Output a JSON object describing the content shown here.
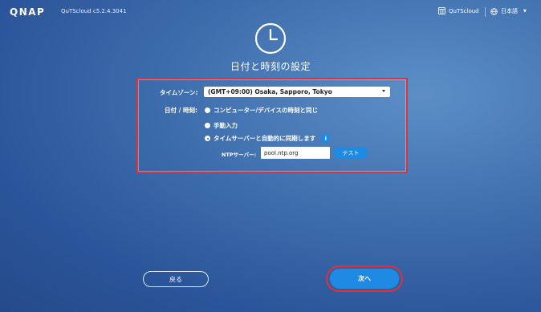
{
  "header": {
    "logo": "QNAP",
    "version": "QuTScloud c5.2.4.3041",
    "product_link": "QuTScloud",
    "language": "日本語"
  },
  "page": {
    "title": "日付と時刻の設定"
  },
  "form": {
    "timezone_label": "タイムゾーン:",
    "timezone_value": "(GMT+09:00) Osaka, Sapporo, Tokyo",
    "datetime_label": "日付 / 時刻:",
    "options": [
      {
        "label": "コンピューター/デバイスの時刻と同じ",
        "selected": false
      },
      {
        "label": "手動入力",
        "selected": false
      },
      {
        "label": "タイムサーバーと自動的に同期します",
        "selected": true
      }
    ],
    "ntp_label": "NTPサーバー:",
    "ntp_value": "pool.ntp.org",
    "test_button": "テスト"
  },
  "footer": {
    "back_button": "戻る",
    "next_button": "次へ"
  },
  "colors": {
    "accent": "#1f8ae3",
    "highlight": "#e0303a"
  },
  "icons": [
    "clock-icon",
    "qutscloud-icon",
    "globe-icon",
    "chevron-down-icon",
    "info-icon"
  ]
}
